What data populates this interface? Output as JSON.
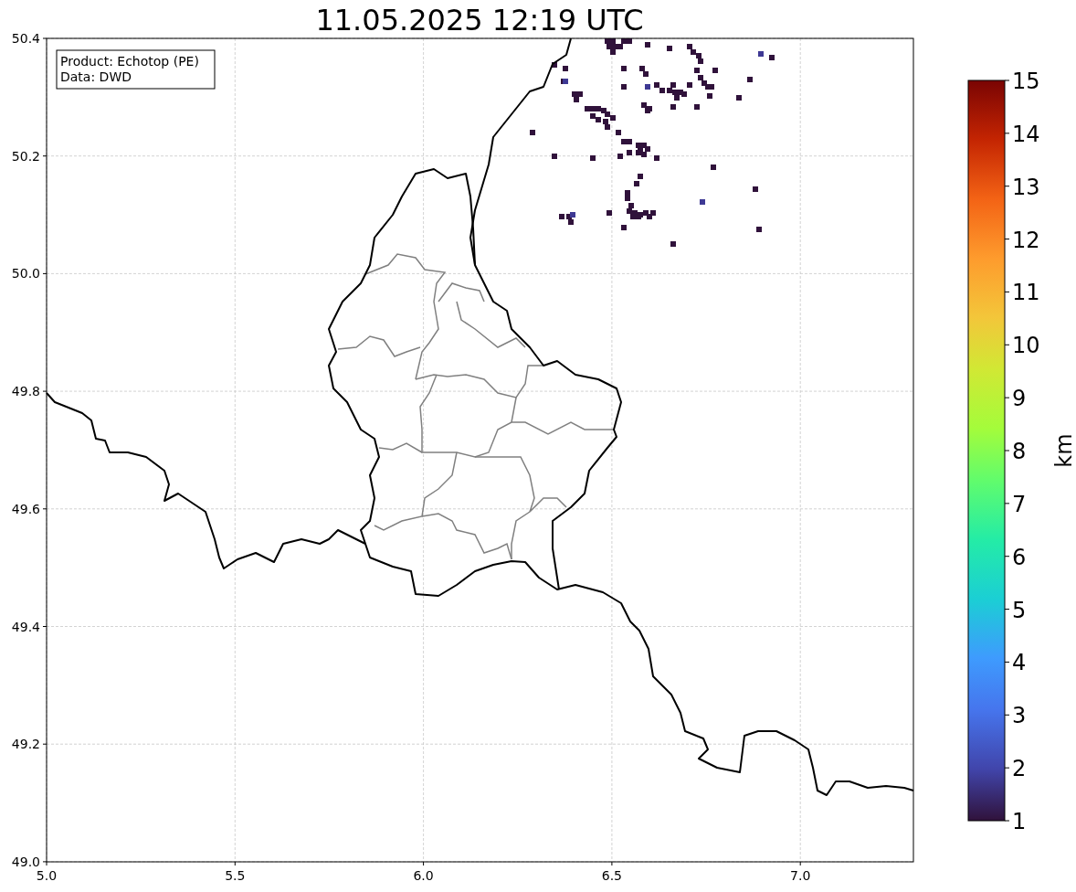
{
  "title": "11.05.2025 12:19 UTC",
  "info_box": {
    "lines": [
      "Product: Echotop (PE)",
      "Data: DWD"
    ]
  },
  "map": {
    "x_ticks": [
      "5.0",
      "5.5",
      "6.0",
      "6.5",
      "7.0"
    ],
    "y_ticks": [
      "50.4",
      "50.2",
      "50.0",
      "49.8",
      "49.6",
      "49.4",
      "49.2",
      "49.0"
    ]
  },
  "colorbar": {
    "label": "km",
    "ticks": [
      "15",
      "14",
      "13",
      "12",
      "11",
      "10",
      "9",
      "8",
      "7",
      "6",
      "5",
      "4",
      "3",
      "2",
      "1"
    ]
  }
}
